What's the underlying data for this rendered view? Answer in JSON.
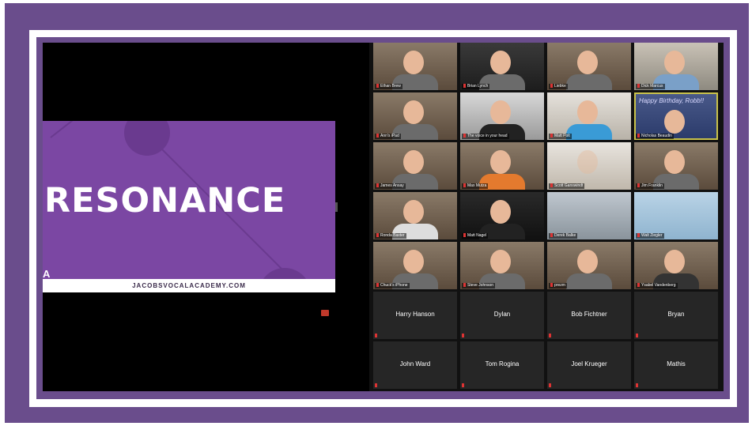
{
  "shared_screen": {
    "slide_title": "RESONANCE",
    "logo_text": "A",
    "footer_url": "JACOBSVOCALACADEMY.COM"
  },
  "participants_video": [
    {
      "name": "Ethan Brew"
    },
    {
      "name": "Brian Lynch"
    },
    {
      "name": "Liebke"
    },
    {
      "name": "Dick Marcus"
    },
    {
      "name": "Ann's iPad"
    },
    {
      "name": "The voice in your head"
    },
    {
      "name": "Matt Polt"
    },
    {
      "name": "Nicholas Beaudin",
      "overlay": "Happy Birthday, Robb!!"
    },
    {
      "name": "James Ansay"
    },
    {
      "name": "Max Mutza"
    },
    {
      "name": "Scott Ganswindt"
    },
    {
      "name": "Jim Franklin"
    },
    {
      "name": "Ronda Baxter"
    },
    {
      "name": "Matt Nagel"
    },
    {
      "name": "Derek Balke"
    },
    {
      "name": "Walt Ziegler"
    },
    {
      "name": "Chuck's iPhone"
    },
    {
      "name": "Steve Johnson"
    },
    {
      "name": "prezm"
    },
    {
      "name": "Ysabel Vandenberg"
    }
  ],
  "participants_audio": [
    {
      "name": "Harry Hanson"
    },
    {
      "name": "Dylan"
    },
    {
      "name": "Bob Fichtner"
    },
    {
      "name": "Bryan"
    },
    {
      "name": "John Ward"
    },
    {
      "name": "Tom Rogina"
    },
    {
      "name": "Joel Krueger"
    },
    {
      "name": "Mathis"
    }
  ],
  "colors": {
    "frame": "#6a4d8c",
    "slide": "#7b47a3",
    "mute": "#dd3333"
  }
}
